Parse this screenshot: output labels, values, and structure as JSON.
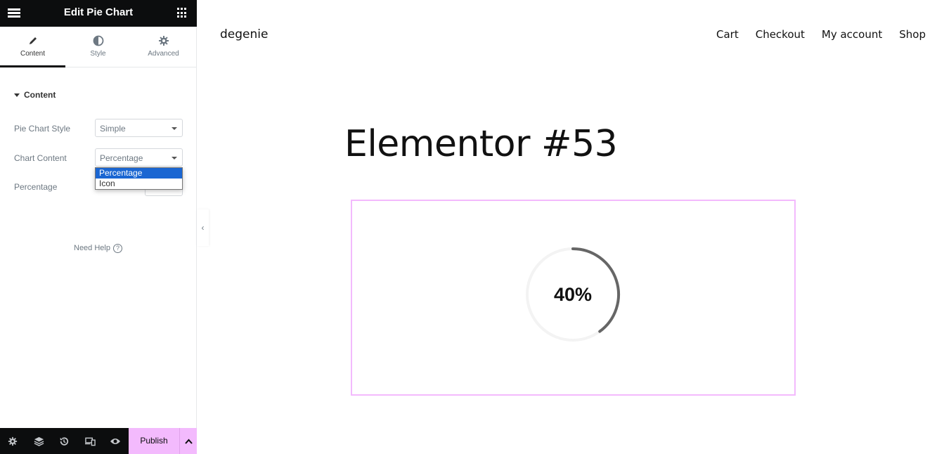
{
  "editor": {
    "title": "Edit Pie Chart",
    "menu_icon": "hamburger-icon",
    "apps_icon": "grid-icon",
    "tabs": [
      {
        "label": "Content",
        "icon": "pencil-icon",
        "active": true
      },
      {
        "label": "Style",
        "icon": "contrast-icon",
        "active": false
      },
      {
        "label": "Advanced",
        "icon": "gear-icon",
        "active": false
      }
    ],
    "section": "Content",
    "controls": {
      "pie_chart_style": {
        "label": "Pie Chart Style",
        "value": "Simple"
      },
      "chart_content": {
        "label": "Chart Content",
        "value": "Percentage",
        "options": [
          "Percentage",
          "Icon"
        ],
        "selected": "Percentage"
      },
      "percentage": {
        "label": "Percentage"
      }
    },
    "need_help": "Need Help",
    "collapse_icon": "‹",
    "footer": {
      "icons": [
        "settings-icon",
        "layers-icon",
        "history-icon",
        "responsive-icon",
        "preview-icon"
      ],
      "publish_label": "Publish"
    }
  },
  "site": {
    "brand": "degenie",
    "nav": [
      "Cart",
      "Checkout",
      "My account",
      "Shop"
    ],
    "page_title": "Elementor #53",
    "pie_chart": {
      "percent": 40,
      "label": "40%",
      "track_color": "#f3f3f3",
      "bar_color": "#666666"
    },
    "accent_color": "#f3bafd"
  }
}
